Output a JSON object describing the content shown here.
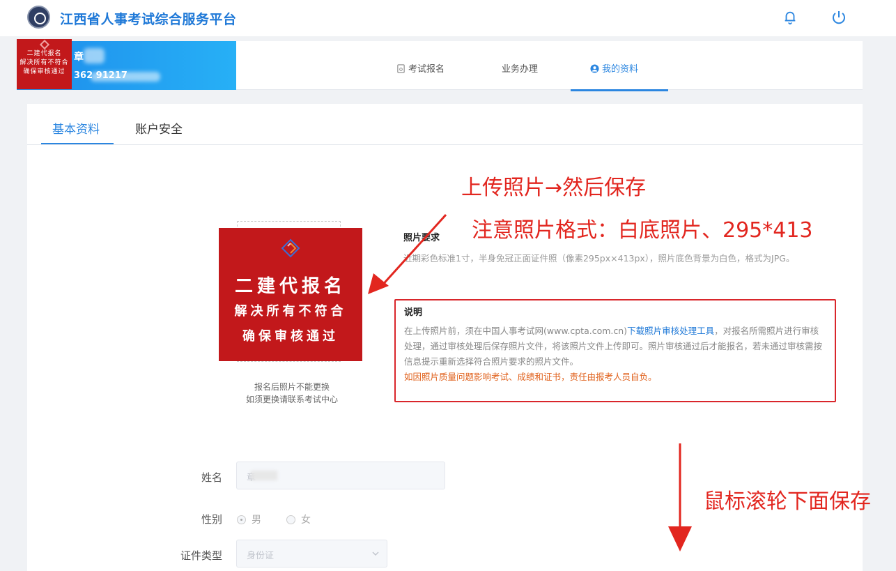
{
  "header": {
    "site_title": "江西省人事考试综合服务平台",
    "icons": [
      "logo-emblem-icon",
      "bell-icon",
      "power-icon"
    ]
  },
  "user": {
    "name": "章",
    "id_number": "362          91217"
  },
  "badge": {
    "line1": "二建代报名",
    "line2": "解决所有不符合",
    "line3": "确保审核通过"
  },
  "nav": {
    "items": [
      {
        "label": "考试报名",
        "icon": "document-icon"
      },
      {
        "label": "业务办理",
        "icon": ""
      },
      {
        "label": "我的资料",
        "icon": "user-circle-icon"
      }
    ],
    "active": "我的资料"
  },
  "tabs": {
    "basic": "基本资料",
    "security": "账户安全",
    "active": "基本资料"
  },
  "photo": {
    "overlay_line1": "二建代报名",
    "overlay_line2": "解决所有不符合",
    "overlay_line3": "确保审核通过",
    "note_line1": "报名后照片不能更换",
    "note_line2": "如须更换请联系考试中心"
  },
  "requirements": {
    "title": "照片要求",
    "text": "近期彩色标准1寸，半身免冠正面证件照（像素295px×413px），照片底色背景为白色，格式为JPG。"
  },
  "explain": {
    "title": "说明",
    "text_before_link": "在上传照片前，须在中国人事考试网(www.cpta.com.cn)",
    "link": "下载照片审核处理工具",
    "text_after_link": "，对报名所需照片进行审核处理，通过审核处理后保存照片文件，将该照片文件上传即可。照片审核通过后才能报名，若未通过审核需按信息提示重新选择符合照片要求的照片文件。",
    "warning": "如因照片质量问题影响考试、成绩和证书，责任由报考人员自负。"
  },
  "form": {
    "name_label": "姓名",
    "name_value": "章",
    "gender_label": "性别",
    "gender_options": [
      "男",
      "女"
    ],
    "gender_selected": "男",
    "id_type_label": "证件类型",
    "id_type_value": "身份证"
  },
  "annotations": {
    "upload_then_save": "上传照片→然后保存",
    "photo_format": "注意照片格式：白底照片、295*413",
    "scroll_save": "鼠标滚轮下面保存"
  },
  "colors": {
    "accent": "#2b86e0",
    "annotation_red": "#e2261f",
    "badge_red": "#c2181b",
    "warning_orange": "#e0611c"
  }
}
